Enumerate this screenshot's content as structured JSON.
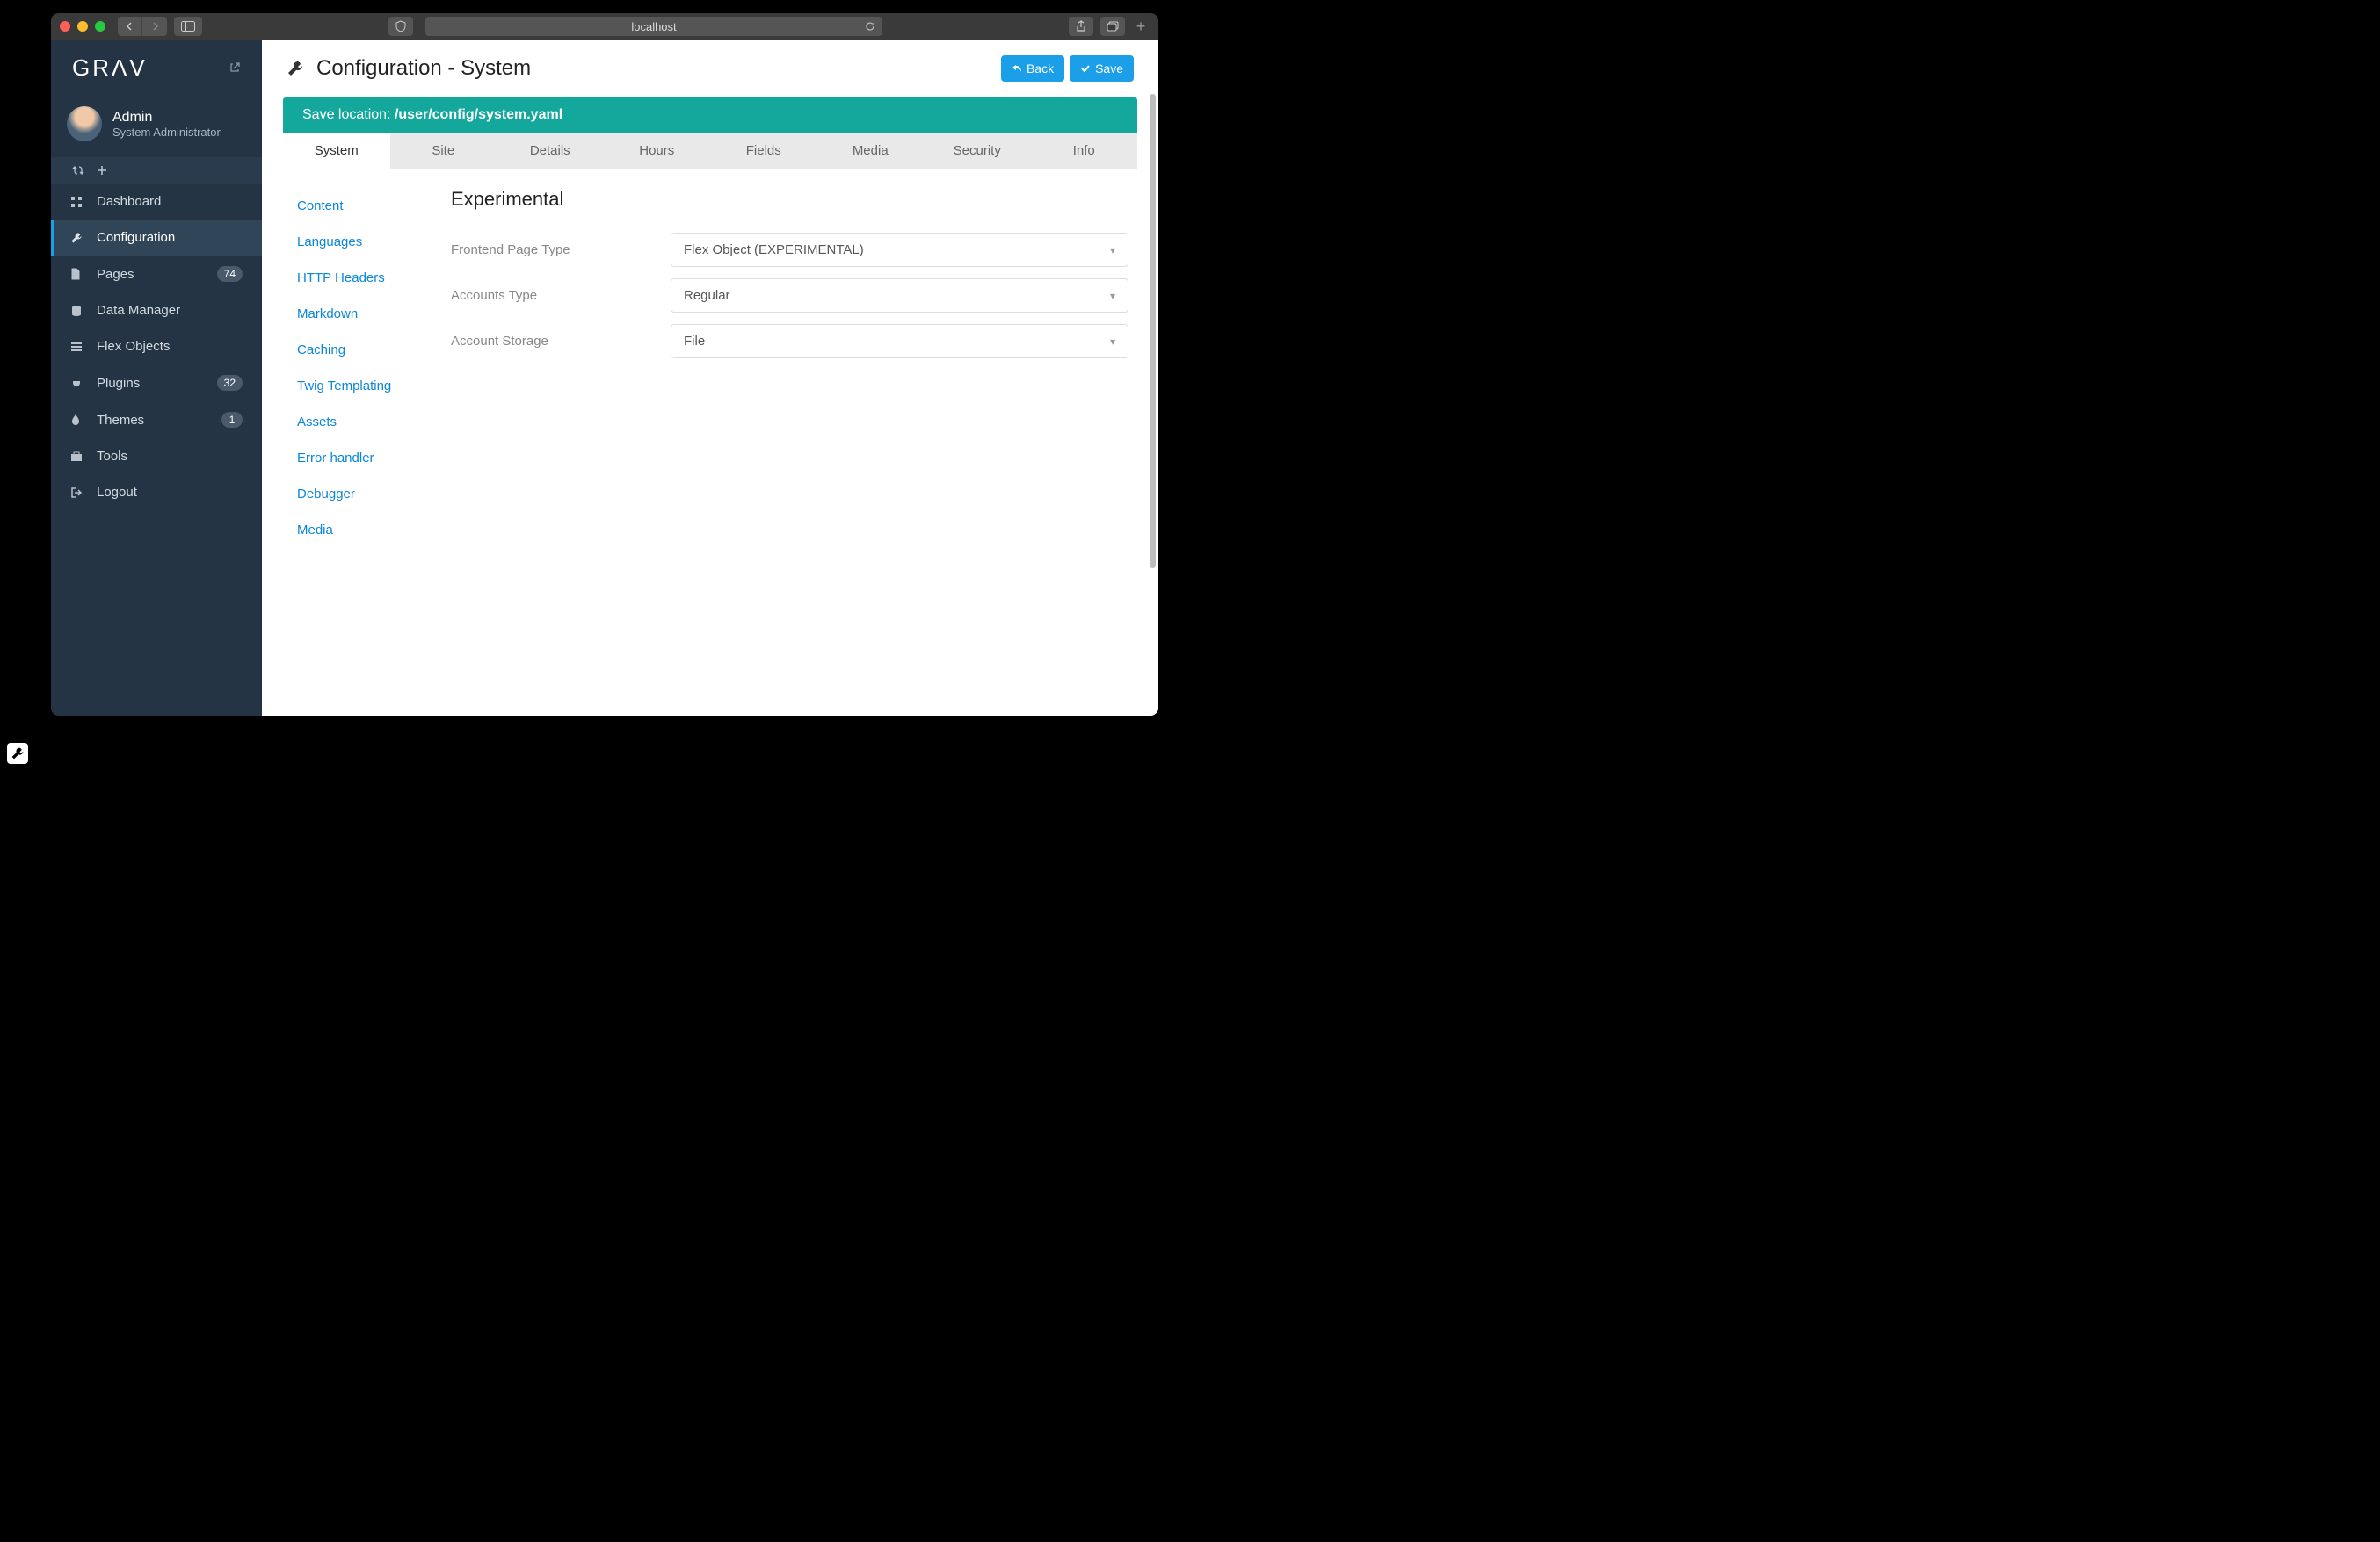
{
  "browser": {
    "address": "localhost"
  },
  "sidebar": {
    "logo": "GRΛV",
    "user": {
      "name": "Admin",
      "role": "System Administrator"
    },
    "items": [
      {
        "label": "Dashboard",
        "icon": "grid",
        "badge": null,
        "active": false
      },
      {
        "label": "Configuration",
        "icon": "wrench",
        "badge": null,
        "active": true
      },
      {
        "label": "Pages",
        "icon": "file",
        "badge": "74",
        "active": false
      },
      {
        "label": "Data Manager",
        "icon": "database",
        "badge": null,
        "active": false
      },
      {
        "label": "Flex Objects",
        "icon": "list",
        "badge": null,
        "active": false
      },
      {
        "label": "Plugins",
        "icon": "plug",
        "badge": "32",
        "active": false
      },
      {
        "label": "Themes",
        "icon": "tint",
        "badge": "1",
        "active": false
      },
      {
        "label": "Tools",
        "icon": "briefcase",
        "badge": null,
        "active": false
      },
      {
        "label": "Logout",
        "icon": "logout",
        "badge": null,
        "active": false
      }
    ]
  },
  "page": {
    "title": "Configuration - System",
    "back_label": "Back",
    "save_label": "Save",
    "save_location_prefix": "Save location: ",
    "save_location_path": "/user/config/system.yaml",
    "tabs": [
      "System",
      "Site",
      "Details",
      "Hours",
      "Fields",
      "Media",
      "Security",
      "Info"
    ],
    "sections": [
      "Content",
      "Languages",
      "HTTP Headers",
      "Markdown",
      "Caching",
      "Twig Templating",
      "Assets",
      "Error handler",
      "Debugger",
      "Media"
    ],
    "form": {
      "heading": "Experimental",
      "rows": [
        {
          "label": "Frontend Page Type",
          "value": "Flex Object (EXPERIMENTAL)"
        },
        {
          "label": "Accounts Type",
          "value": "Regular"
        },
        {
          "label": "Account Storage",
          "value": "File"
        }
      ]
    }
  }
}
